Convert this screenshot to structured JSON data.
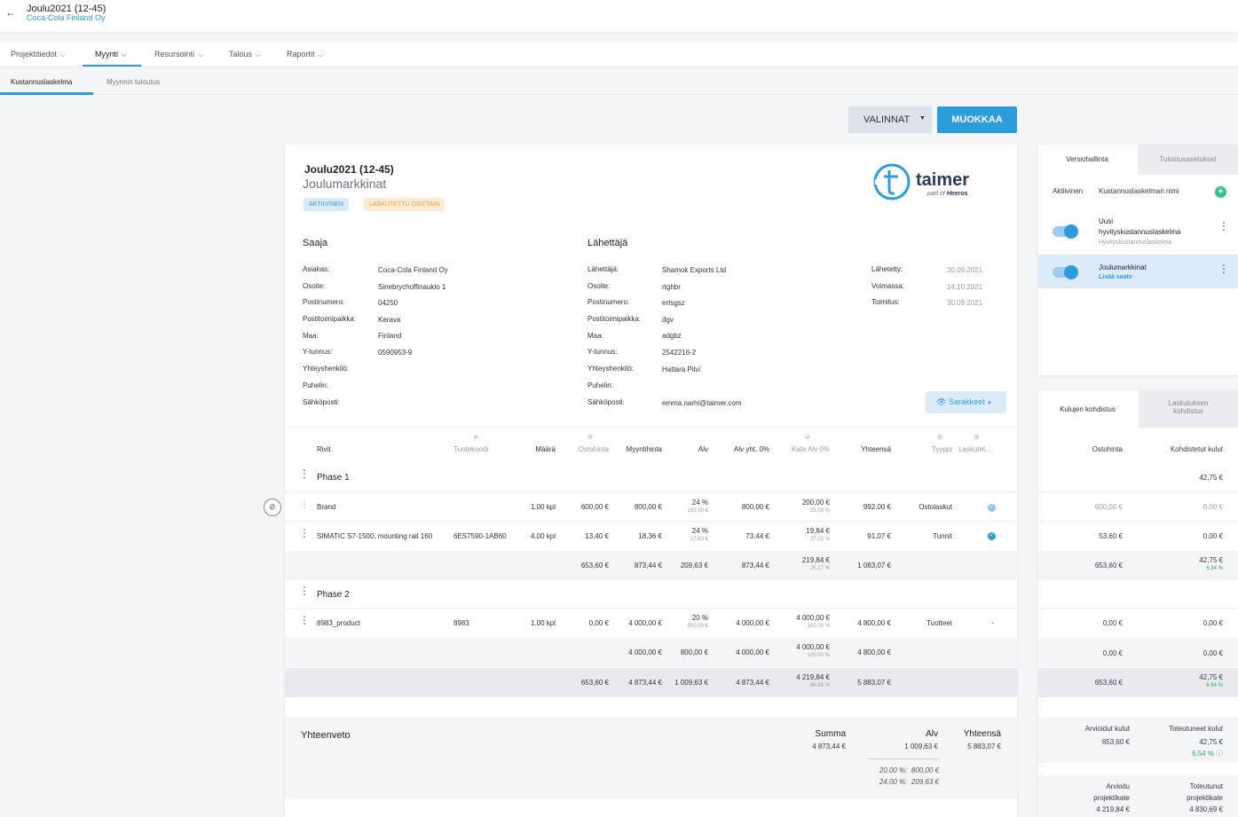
{
  "header": {
    "back_icon": "arrow-left-icon",
    "title": "Joulu2021 (12-45)",
    "subtitle": "Coca-Cola Finland Oy"
  },
  "nav": {
    "items": [
      "Projektitiedot",
      "Myynti",
      "Resursointi",
      "Talous",
      "Raportit"
    ],
    "active": "Myynti"
  },
  "subnav": {
    "items": [
      "Kustannuslaskelma",
      "Myynnin tuloutus"
    ]
  },
  "toolbar": {
    "valinnat": "VALINNAT",
    "muokkaa": "MUOKKAA"
  },
  "doc": {
    "title": "Joulu2021 (12-45)",
    "name": "Joulumarkkinat",
    "badges": [
      "AKTIIVINEN",
      "LASKUTETTU OSITTAIN"
    ],
    "logo_text": "taimer",
    "logo_sub": "part of",
    "logo_brand": "Heeros",
    "receiver": {
      "heading": "Saaja",
      "labels": [
        "Asiakas:",
        "Osoite:",
        "Postinumero:",
        "Postitoimipaikka:",
        "Maa:",
        "Y-tunnus:",
        "Yhteyshenkilö:",
        "Puhelin:",
        "Sähköposti:"
      ],
      "values": [
        "Coca-Cola Finland Oy",
        "Sinebrychoffinaukio 1",
        "04250",
        "Kerava",
        "Finland",
        "0590953-9",
        "",
        "",
        ""
      ]
    },
    "sender": {
      "heading": "Lähettäjä",
      "labels": [
        "Lähettäjä:",
        "Osoite:",
        "Postinumero:",
        "Postitoimipaikka:",
        "Maa:",
        "Y-tunnus:",
        "Yhteyshenkilö:",
        "Puhelin:",
        "Sähköposti:"
      ],
      "values": [
        "Shamok Exports Ltd",
        "rtghbr",
        "ertsgsz",
        "dgv",
        "adgbz",
        "2542216-2",
        "Hattara Pilvi",
        "",
        "emma.narhi@taimer.com"
      ]
    },
    "dates": {
      "labels": [
        "Lähetetty:",
        "Voimassa:",
        "Toimitus:"
      ],
      "values": [
        "30.09.2021",
        "14.10.2021",
        "30.09.2021"
      ]
    },
    "sarakkeet": "Sarakkeet"
  },
  "table": {
    "headers": {
      "rivit": "Rivit",
      "tuotekoodi": "Tuotekoodi",
      "maara": "Määrä",
      "ostohinta": "Ostohinta",
      "myyntihinta": "Myyntihinta",
      "alv": "Alv",
      "alv_yht": "Alv yht. 0%",
      "kate": "Kate Alv 0%",
      "yhteensa": "Yhteensä",
      "tyyppi": "Tyyppi",
      "laskutettu": "Laskutet..."
    },
    "phase1": "Phase 1",
    "phase2": "Phase 2",
    "rows": [
      {
        "name": "Brand",
        "code": "",
        "qty": "1.00 kpl",
        "purchase": "600,00 €",
        "price": "800,00 €",
        "vat": "24 %",
        "vat_sub": "192,00 €",
        "vat_total": "800,00 €",
        "margin": "200,00 €",
        "margin_sub": "25.00 %",
        "total": "992,00 €",
        "type": "Ostolaskut"
      },
      {
        "name": "SIMATIC S7-1500, mounting rail 160",
        "code": "6ES7590-1AB60",
        "qty": "4.00 kpl",
        "purchase": "13,40 €",
        "price": "18,36 €",
        "vat": "24 %",
        "vat_sub": "17,63 €",
        "vat_total": "73,44 €",
        "margin": "19,84 €",
        "margin_sub": "27.02 %",
        "total": "91,07 €",
        "type": "Tunnit"
      },
      {
        "name": "8983_product",
        "code": "8983",
        "qty": "1.00 kpl",
        "purchase": "0,00 €",
        "price": "4 000,00 €",
        "vat": "20 %",
        "vat_sub": "800,00 €",
        "vat_total": "4 000,00 €",
        "margin": "4 000,00 €",
        "margin_sub": "100.00 %",
        "total": "4 800,00 €",
        "type": "Tuotteet",
        "invoiced": "-"
      }
    ],
    "sub1": {
      "purchase": "653,60 €",
      "price": "873,44 €",
      "vat": "209,63 €",
      "vat_total": "873,44 €",
      "margin": "219,84 €",
      "margin_sub": "25.17 %",
      "total": "1 083,07 €"
    },
    "sub2": {
      "price": "4 000,00 €",
      "vat": "800,00 €",
      "vat_total": "4 000,00 €",
      "margin": "4 000,00 €",
      "margin_sub": "100.00 %",
      "total": "4 800,00 €"
    },
    "grand": {
      "purchase": "653,60 €",
      "price": "4 873,44 €",
      "vat": "1 009,63 €",
      "vat_total": "4 873,44 €",
      "margin": "4 219,84 €",
      "margin_sub": "86.59 %",
      "total": "5 883,07 €"
    }
  },
  "summary": {
    "title": "Yhteenveto",
    "summa_label": "Summa",
    "summa": "4 873,44 €",
    "alv_label": "Alv",
    "alv": "1 009,63 €",
    "yht_label": "Yhteensä",
    "yht": "5 883,07 €",
    "vat_line1": "20.00 %:  800,00 €",
    "vat_line2": "24.00 %:  209,63 €"
  },
  "versions": {
    "tabs": [
      "Versiohallinta",
      "Tulostusasetukset"
    ],
    "col_active": "Aktiivinen",
    "col_name": "Kustannuslaskelman nimi",
    "items": [
      {
        "line1": "Uusi",
        "line2": "hyvityskustannuslaskelma",
        "sub": "Hyvityskustannuslaskelma"
      },
      {
        "line1": "Joulumarkkinat",
        "sub": "Lisää saate"
      }
    ]
  },
  "costs": {
    "tabs": [
      "Kulujen kohdistus",
      "Laskutuksen kohdistus"
    ],
    "headers": [
      "Ostohinta",
      "Kohdistetut kulut"
    ],
    "phase1_alloc": "42,75 €",
    "rows": [
      {
        "purchase": "600,00 €",
        "alloc": "0,00 €"
      },
      {
        "purchase": "53,60 €",
        "alloc": "0,00 €"
      },
      {
        "purchase": "653,60 €",
        "alloc": "42,75 €",
        "alloc_sub": "6.54 %"
      },
      {
        "purchase": "0,00 €",
        "alloc": "0,00 €"
      },
      {
        "purchase": "0,00 €",
        "alloc": "0,00 €"
      },
      {
        "purchase": "653,60 €",
        "alloc": "42,75 €",
        "alloc_sub": "6.54 %"
      }
    ],
    "est_label": "Arvioidut kulut",
    "est": "653,60 €",
    "real_label": "Toteutuneet kulut",
    "real": "42,75 €",
    "real_pct": "6.54 %",
    "est_margin_label1": "Arvioitu",
    "est_margin_label2": "projektikate",
    "est_margin": "4 219,84 €",
    "real_margin_label1": "Toteutunut",
    "real_margin_label2": "projektikate",
    "real_margin": "4 830,69 €"
  }
}
